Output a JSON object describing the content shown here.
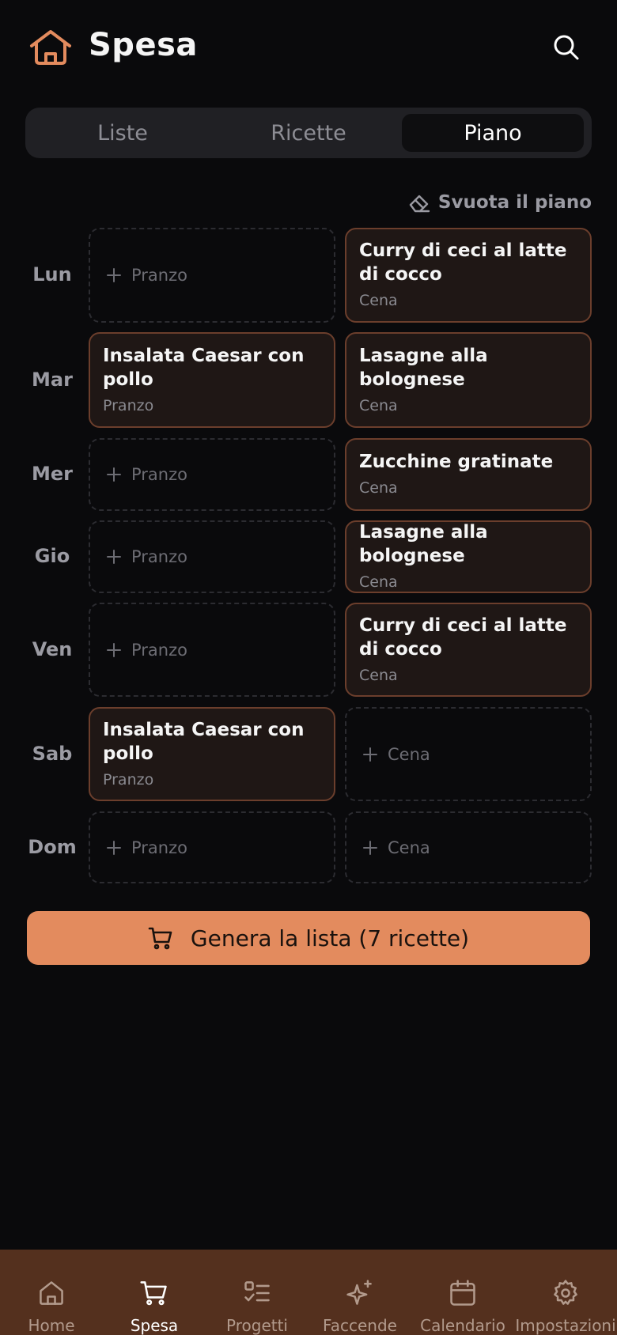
{
  "header": {
    "title": "Spesa",
    "logo_icon": "home-icon",
    "search_icon": "search-icon",
    "accent": "#e38b5e"
  },
  "tabs": [
    {
      "label": "Liste",
      "active": false
    },
    {
      "label": "Ricette",
      "active": false
    },
    {
      "label": "Piano",
      "active": true
    }
  ],
  "clear_plan": {
    "label": "Svuota il piano",
    "icon": "eraser-icon"
  },
  "days": [
    {
      "day": "Lun",
      "lunch": {
        "filled": false,
        "placeholder": "Pranzo"
      },
      "dinner": {
        "filled": true,
        "recipe": "Curry di ceci al latte di cocco",
        "meal": "Cena"
      }
    },
    {
      "day": "Mar",
      "lunch": {
        "filled": true,
        "recipe": "Insalata Caesar con pollo",
        "meal": "Pranzo"
      },
      "dinner": {
        "filled": true,
        "recipe": "Lasagne alla bolognese",
        "meal": "Cena"
      }
    },
    {
      "day": "Mer",
      "lunch": {
        "filled": false,
        "placeholder": "Pranzo"
      },
      "dinner": {
        "filled": true,
        "recipe": "Zucchine gratinate",
        "meal": "Cena"
      }
    },
    {
      "day": "Gio",
      "lunch": {
        "filled": false,
        "placeholder": "Pranzo"
      },
      "dinner": {
        "filled": true,
        "recipe": "Lasagne alla bolognese",
        "meal": "Cena"
      }
    },
    {
      "day": "Ven",
      "lunch": {
        "filled": false,
        "placeholder": "Pranzo"
      },
      "dinner": {
        "filled": true,
        "recipe": "Curry di ceci al latte di cocco",
        "meal": "Cena"
      }
    },
    {
      "day": "Sab",
      "lunch": {
        "filled": true,
        "recipe": "Insalata Caesar con pollo",
        "meal": "Pranzo"
      },
      "dinner": {
        "filled": false,
        "placeholder": "Cena"
      }
    },
    {
      "day": "Dom",
      "lunch": {
        "filled": false,
        "placeholder": "Pranzo"
      },
      "dinner": {
        "filled": false,
        "placeholder": "Cena"
      }
    }
  ],
  "generate_button": {
    "label": "Genera la lista (7 ricette)",
    "icon": "cart-icon"
  },
  "bottom_nav": [
    {
      "label": "Home",
      "icon": "home-icon",
      "active": false
    },
    {
      "label": "Spesa",
      "icon": "cart-icon",
      "active": true
    },
    {
      "label": "Progetti",
      "icon": "checklist-icon",
      "active": false
    },
    {
      "label": "Faccende",
      "icon": "sparkles-icon",
      "active": false
    },
    {
      "label": "Calendario",
      "icon": "calendar-icon",
      "active": false
    },
    {
      "label": "Impostazioni",
      "icon": "gear-icon",
      "active": false
    }
  ]
}
